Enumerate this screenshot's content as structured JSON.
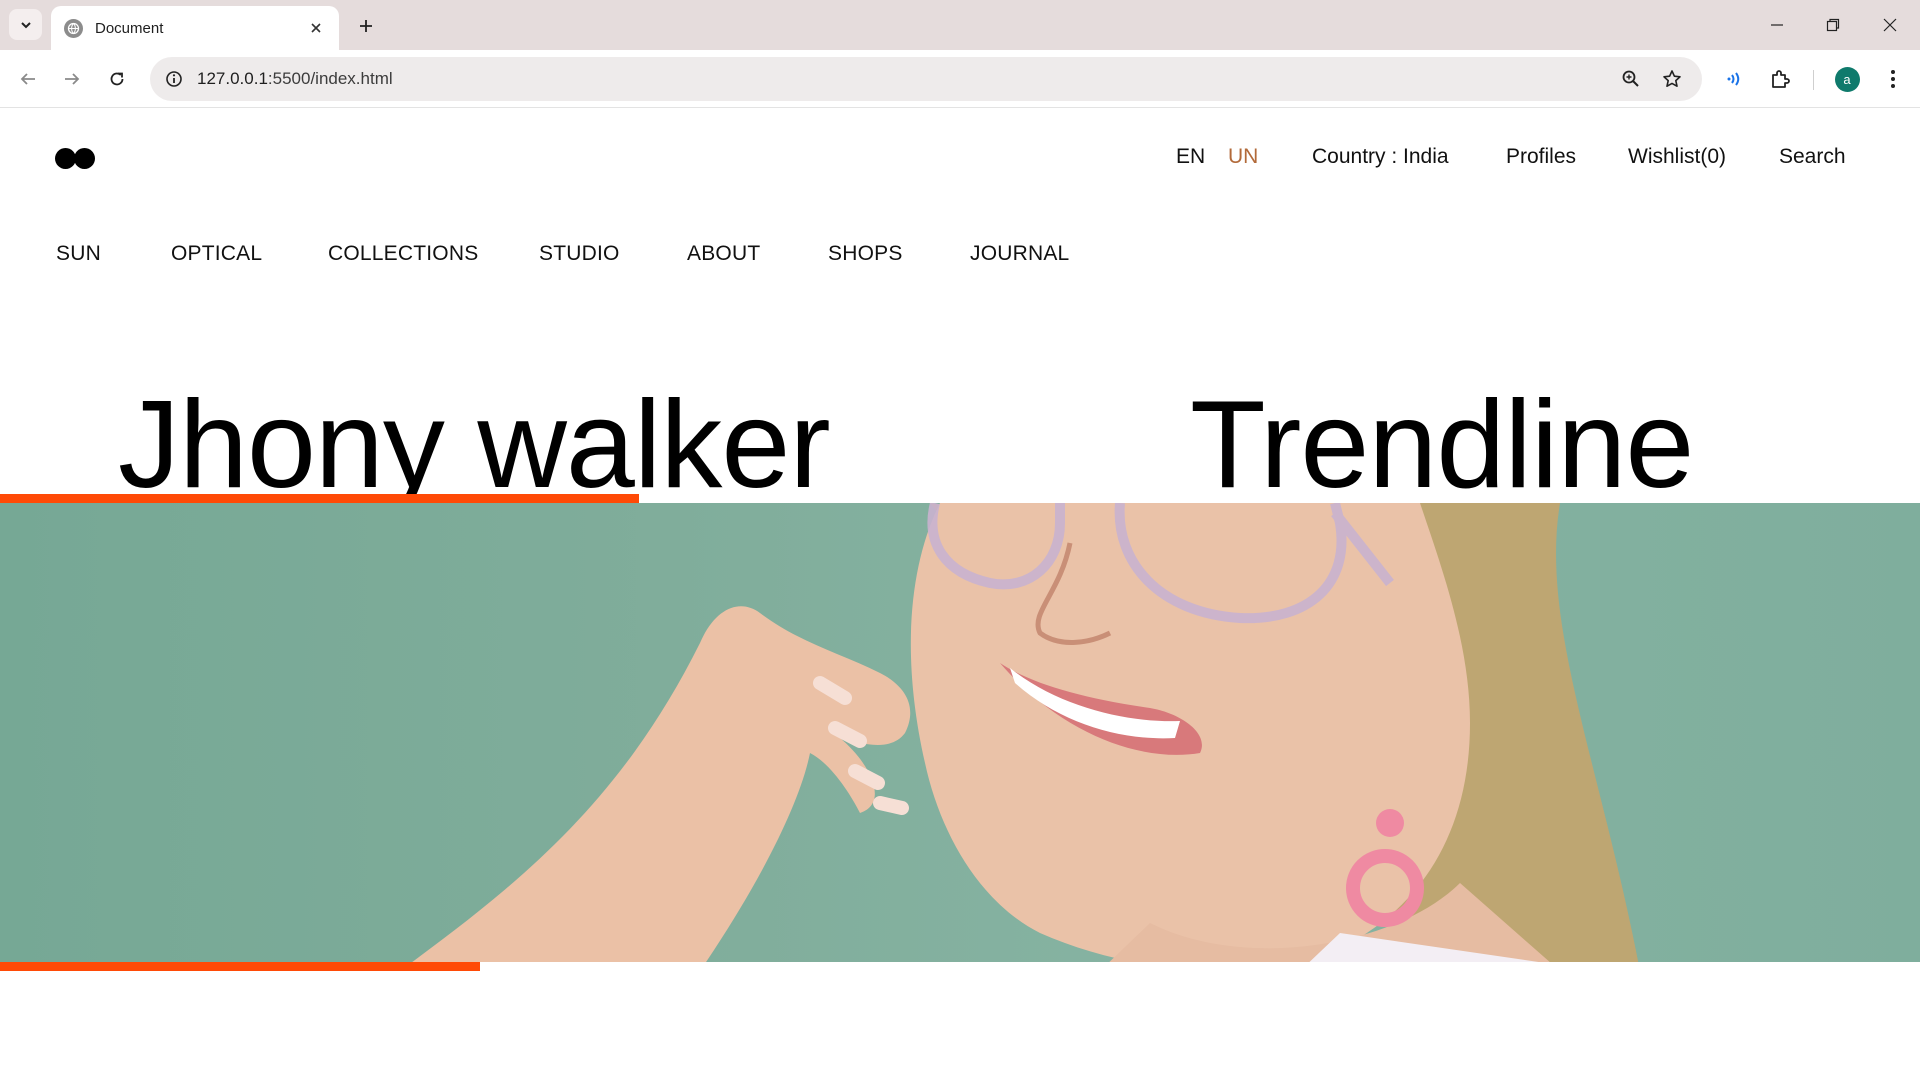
{
  "browser": {
    "tab_title": "Document",
    "url_host": "127.0.0.1",
    "url_rest": ":5500/index.html",
    "profile_initial": "a"
  },
  "icons": {
    "tab_dropdown": "chevron-down-icon",
    "favicon": "globe-icon",
    "tab_close": "close-icon",
    "new_tab": "plus-icon",
    "back": "arrow-left-icon",
    "forward": "arrow-right-icon",
    "reload": "reload-icon",
    "site_info": "info-icon",
    "zoom": "zoom-icon",
    "bookmark": "star-icon",
    "extensions": "puzzle-icon",
    "menu": "kebab-icon"
  },
  "header": {
    "lang_primary": "EN",
    "lang_secondary": "UN",
    "country": "Country : India",
    "profiles": "Profiles",
    "wishlist": "Wishlist(0)",
    "search": "Search"
  },
  "nav": {
    "items": [
      "SUN",
      "OPTICAL",
      "COLLECTIONS",
      "STUDIO",
      "ABOUT",
      "SHOPS",
      "JOURNAL"
    ]
  },
  "hero": {
    "title_left": "Jhony walker",
    "title_right": "Trendline",
    "slide_progress_top": 0.333,
    "slide_progress_bottom": 0.25
  },
  "colors": {
    "accent": "#ff4a06",
    "hero_bg": "#80ad9b",
    "secondary_lang": "#b26a3a"
  }
}
